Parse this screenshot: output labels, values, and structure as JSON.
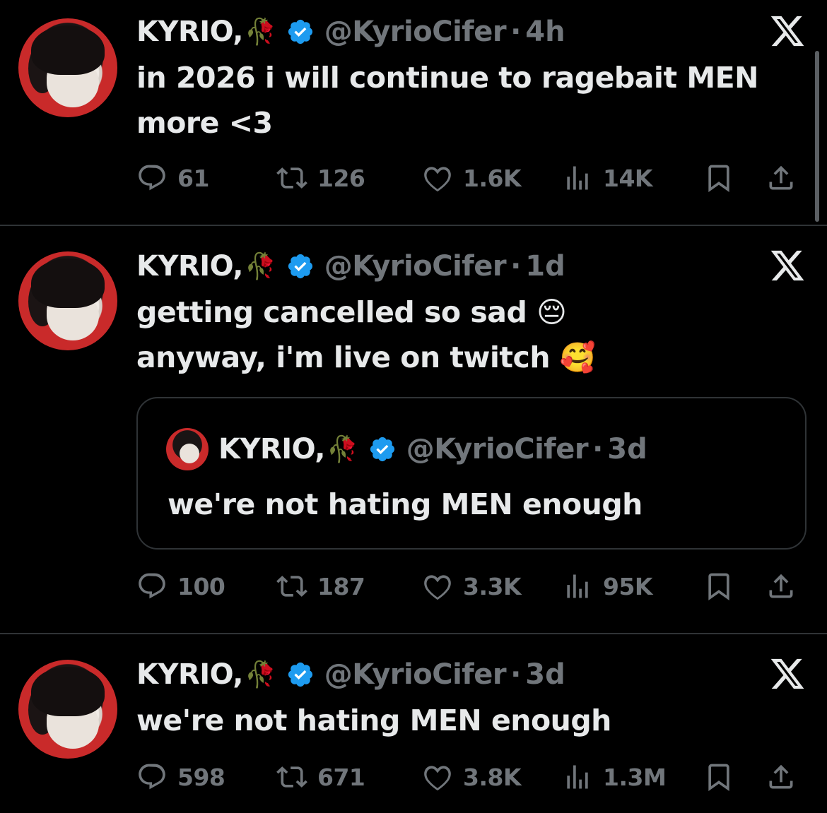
{
  "colors": {
    "background": "#000000",
    "text": "#e7e9ea",
    "muted": "#71767b",
    "verified": "#1d9bf0",
    "divider": "#2f3336"
  },
  "tweets": [
    {
      "name": "KYRIO,",
      "rose": "🥀",
      "handle": "@KyrioCifer",
      "time": "4h",
      "text_lines": [
        "in 2026 i will continue to ragebait MEN",
        "more <3"
      ],
      "replies": "61",
      "reposts": "126",
      "likes": "1.6K",
      "views": "14K"
    },
    {
      "name": "KYRIO,",
      "rose": "🥀",
      "handle": "@KyrioCifer",
      "time": "1d",
      "text_lines": [
        "getting cancelled so sad 😔",
        "anyway, i'm live on twitch 🥰"
      ],
      "quote": {
        "name": "KYRIO,",
        "rose": "🥀",
        "handle": "@KyrioCifer",
        "time": "3d",
        "text": "we're not hating MEN enough"
      },
      "replies": "100",
      "reposts": "187",
      "likes": "3.3K",
      "views": "95K"
    },
    {
      "name": "KYRIO,",
      "rose": "🥀",
      "handle": "@KyrioCifer",
      "time": "3d",
      "text_lines": [
        "we're not hating MEN enough"
      ],
      "replies": "598",
      "reposts": "671",
      "likes": "3.8K",
      "views": "1.3M"
    }
  ],
  "separator": "·",
  "icons": [
    "reply-icon",
    "repost-icon",
    "like-icon",
    "views-icon",
    "bookmark-icon",
    "share-icon",
    "verified-icon",
    "x-logo-icon"
  ]
}
